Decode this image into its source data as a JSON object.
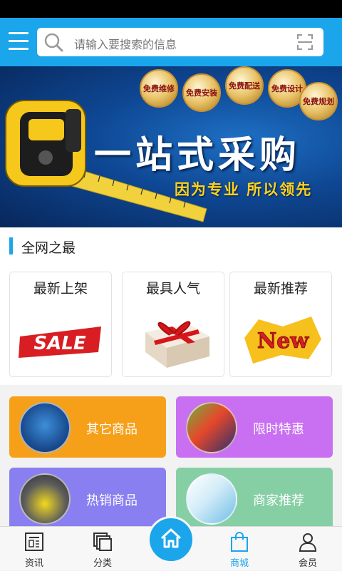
{
  "search": {
    "placeholder": "请输入要搜索的信息"
  },
  "banner": {
    "title": "一站式采购",
    "subtitle": "因为专业 所以领先",
    "medals": [
      "免费维修",
      "免费安装",
      "免费配送",
      "免费设计",
      "免费规划"
    ]
  },
  "section": {
    "title": "全网之最"
  },
  "cards": [
    {
      "label": "最新上架",
      "art_text": "SALE"
    },
    {
      "label": "最具人气"
    },
    {
      "label": "最新推荐",
      "art_text": "New"
    }
  ],
  "tiles": [
    {
      "label": "其它商品",
      "color": "#f6a01a"
    },
    {
      "label": "限时特惠",
      "color": "#c86ff2"
    },
    {
      "label": "热销商品",
      "color": "#8a7ff0"
    },
    {
      "label": "商家推荐",
      "color": "#86cfa5"
    }
  ],
  "tabbar": {
    "items": [
      {
        "label": "资讯",
        "icon": "news-icon"
      },
      {
        "label": "分类",
        "icon": "category-icon"
      },
      {
        "label": "商城",
        "icon": "shopping-bag-icon",
        "active": true
      },
      {
        "label": "会员",
        "icon": "user-icon"
      }
    ],
    "home_icon": "home-icon",
    "accent": "#1ba6ec"
  }
}
